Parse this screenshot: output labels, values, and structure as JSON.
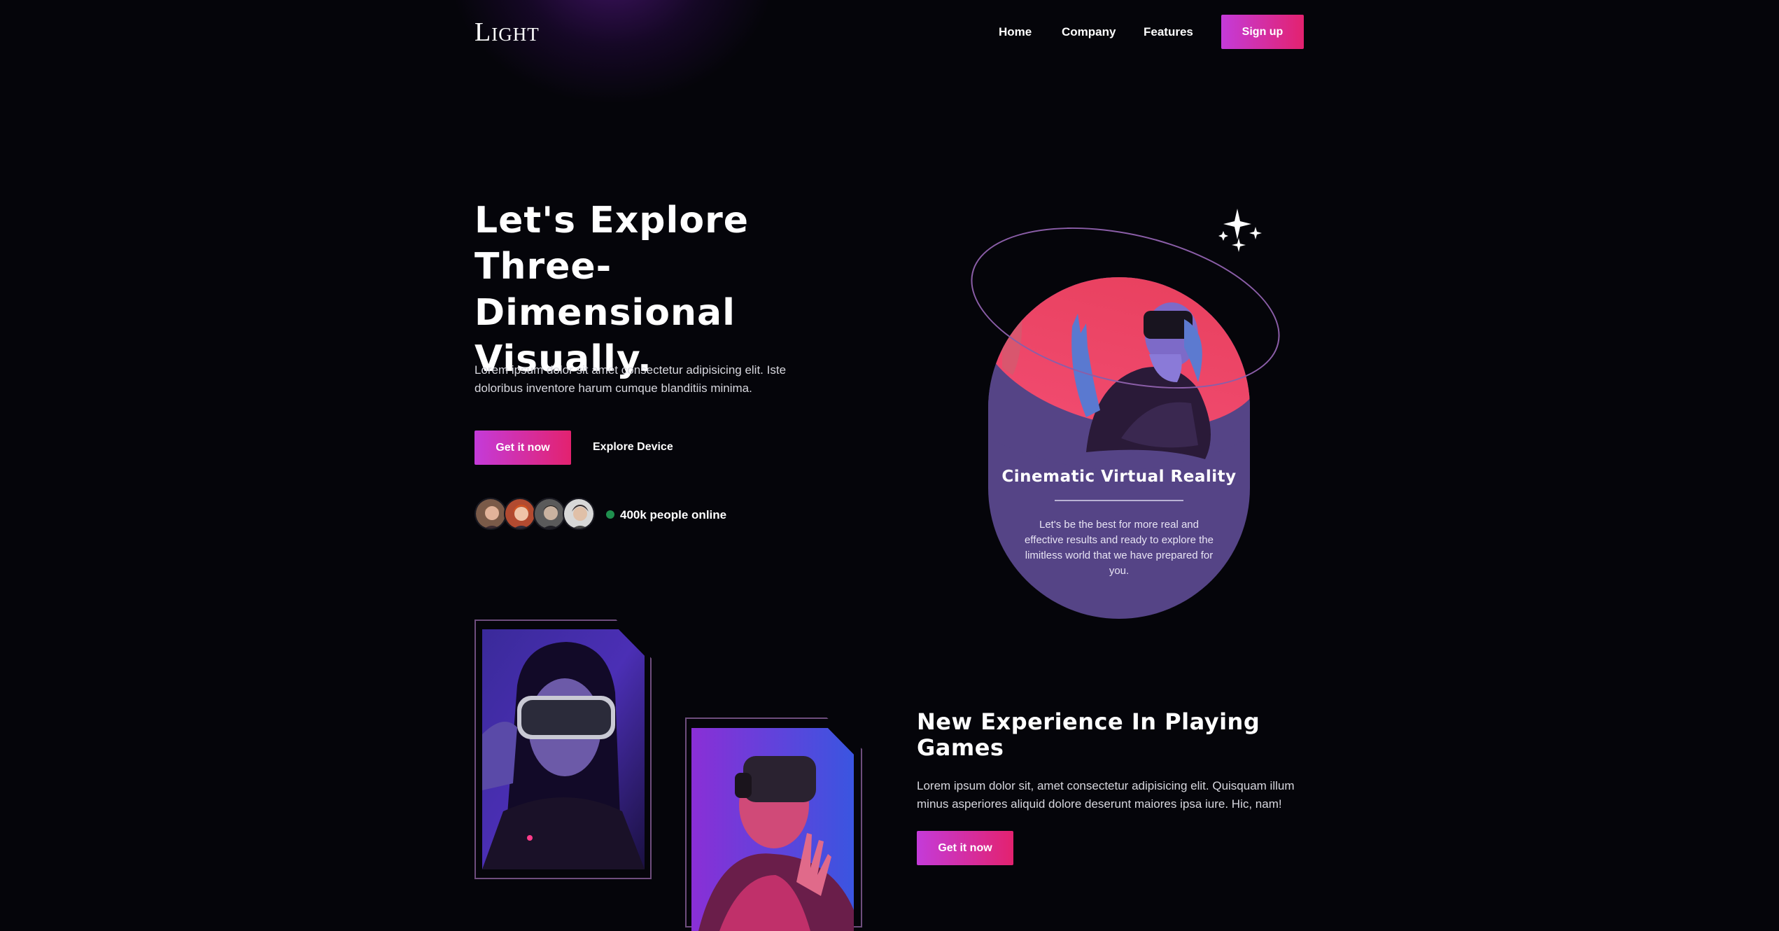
{
  "nav": {
    "logo": "Light",
    "links": [
      "Home",
      "Company",
      "Features"
    ],
    "signup_label": "Sign up"
  },
  "hero": {
    "title_lines": [
      "Let's Explore",
      "Three-Dimensional",
      "Visually."
    ],
    "description": "Lorem ipsum dolor sit amet consectetur adipisicing elit. Iste doloribus inventore harum cumque blanditiis minima.",
    "primary_cta": "Get it now",
    "secondary_cta": "Explore Device",
    "online_text": "400k people online"
  },
  "vr_card": {
    "title": "Cinematic Virtual Reality",
    "description": "Let's be the best for more real and effective results and ready to explore the limitless world that we have prepared for you."
  },
  "section": {
    "title": "New Experience In Playing Games",
    "description": "Lorem ipsum dolor sit, amet consectetur adipisicing elit. Quisquam illum minus asperiores aliquid dolore deserunt maiores ipsa iure. Hic, nam!",
    "cta": "Get it now"
  },
  "colors": {
    "background": "#05050a",
    "accent_start": "#c43bd9",
    "accent_end": "#e3226f",
    "card": "#554486",
    "online": "#1f8f4e"
  }
}
